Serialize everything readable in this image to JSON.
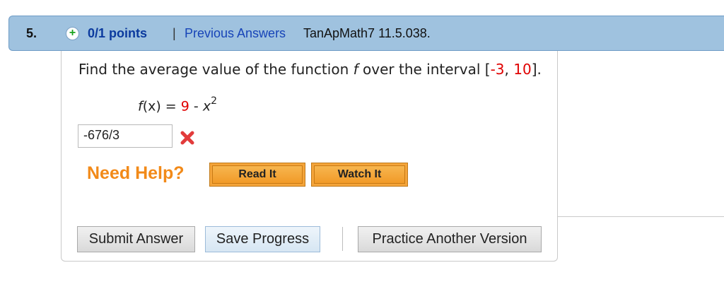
{
  "header": {
    "question_number": "5.",
    "plus_icon": "plus-circle-icon",
    "points": "0/1 points",
    "separator": "|",
    "previous_answers": "Previous Answers",
    "problem_code": "TanApMath7 11.5.038."
  },
  "question": {
    "text_before": "Find the average value of the function ",
    "func_var": "f",
    "text_middle": " over the interval [",
    "interval_start": "-3",
    "comma": ", ",
    "interval_end": "10",
    "text_after": "]."
  },
  "function": {
    "lhs_f": "f",
    "lhs_rest": "(x) = ",
    "constant": "9",
    "minus": " - ",
    "var": "x",
    "exponent": "2"
  },
  "answer": {
    "value": "-676/3",
    "status_icon": "x-mark-icon"
  },
  "help": {
    "label": "Need Help?",
    "read_it": "Read It",
    "watch_it": "Watch It"
  },
  "actions": {
    "submit": "Submit Answer",
    "save": "Save Progress",
    "practice": "Practice Another Version"
  },
  "colors": {
    "header_bg": "#9fc2df",
    "link_blue": "#1744b8",
    "highlight_red": "#e00000",
    "help_orange": "#f28a19",
    "button_orange": "#f4a43a"
  }
}
